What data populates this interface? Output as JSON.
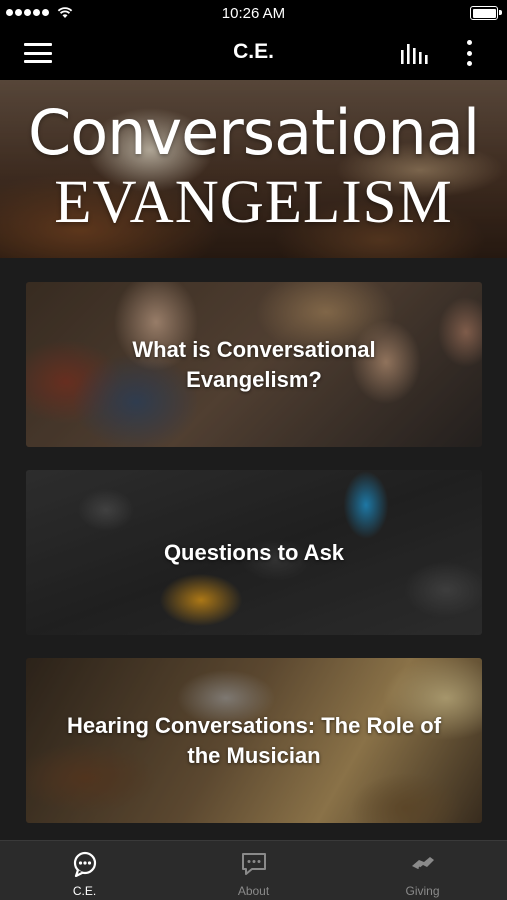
{
  "status_bar": {
    "time": "10:26 AM"
  },
  "nav": {
    "title": "C.E."
  },
  "hero": {
    "title": "Conversational",
    "subtitle": "EVANGELISM"
  },
  "cards": [
    {
      "label": "What is Conversational Evangelism?"
    },
    {
      "label": "Questions to Ask"
    },
    {
      "label": "Hearing Conversations:  The Role of the Musician"
    }
  ],
  "tabs": [
    {
      "label": "C.E.",
      "icon": "chat-bubble-icon",
      "active": true
    },
    {
      "label": "About",
      "icon": "message-icon",
      "active": false
    },
    {
      "label": "Giving",
      "icon": "handshake-icon",
      "active": false
    }
  ],
  "colors": {
    "background": "#1c1c1c",
    "bar": "#000000",
    "tab_bar": "#2b2b2b",
    "active_tab": "#ffffff",
    "inactive_tab": "#8a8a8a"
  }
}
